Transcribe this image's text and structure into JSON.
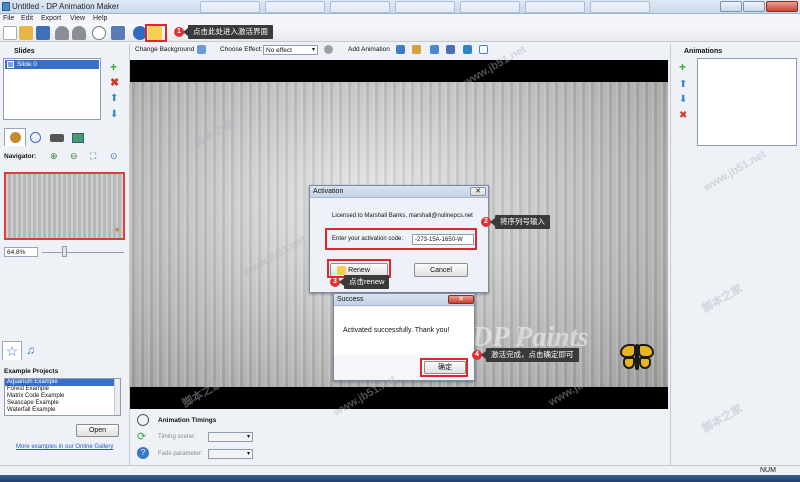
{
  "window": {
    "title": "Untitled - DP Animation Maker"
  },
  "menu": [
    "File",
    "Edit",
    "Export",
    "View",
    "Help"
  ],
  "toolbar": {
    "change_background": "Change Background",
    "choose_effect": "Choose Effect:",
    "effect_value": "No effect",
    "add_animation": "Add Animation"
  },
  "callouts": {
    "c1": "点击此处进入激活界面",
    "c2": "将序列号输入",
    "c3": "点击renew",
    "c4": "激活完成，点击确定即可"
  },
  "steps": [
    "1",
    "2",
    "3",
    "4"
  ],
  "slides": {
    "header": "Slides",
    "items": [
      "Slide 0"
    ]
  },
  "navigator": {
    "label": "Navigator:",
    "zoom": "64.8%"
  },
  "examples": {
    "header": "Example Projects",
    "items": [
      "Aquarium Example",
      "Forest Example",
      "Matrix Code Example",
      "Seascape Example",
      "Waterfall Example"
    ],
    "open_label": "Open",
    "gallery_link": "More examples in our Online Gallery"
  },
  "animations": {
    "header": "Animations"
  },
  "timings": {
    "header": "Animation Timings",
    "timing_scene": "Timing scene:",
    "fade_param": "Fade parameter:"
  },
  "activation": {
    "title": "Activation",
    "licensed": "Licensed to Marshall Banks, marshall@nulinepcs.net",
    "code_label": "Enter your activation code:",
    "code_value": "-273-15A-1650-W",
    "renew": "Renew",
    "cancel": "Cancel"
  },
  "success": {
    "title": "Success",
    "message": "Activated successfully. Thank you!",
    "ok": "确定"
  },
  "stage": {
    "watermark": "DP Paints"
  },
  "watermarks": [
    "脚本之家",
    "www.jb51.net"
  ],
  "statusbar": {
    "num": "NUM"
  }
}
